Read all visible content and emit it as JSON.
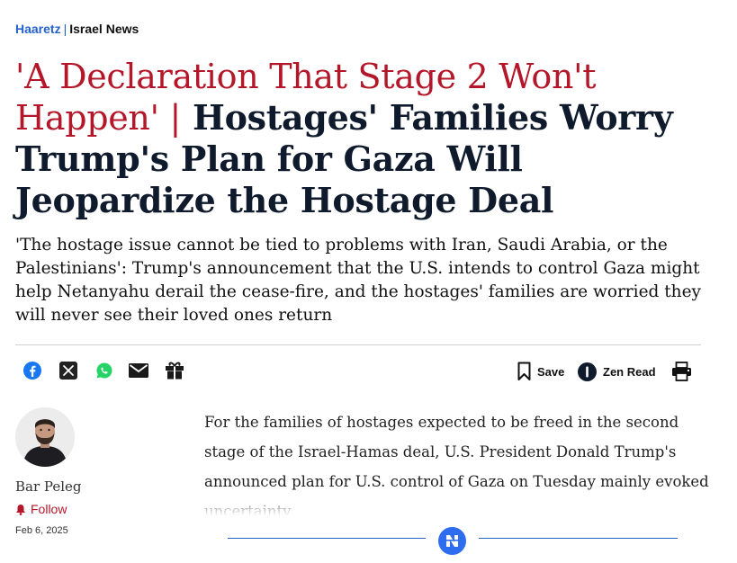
{
  "breadcrumb": {
    "brand": "Haaretz",
    "separator": "|",
    "section": "Israel News"
  },
  "headline": {
    "kicker": "'A Declaration That Stage 2 Won't Happen' |",
    "title": "Hostages' Families Worry Trump's Plan for Gaza Will Jeopardize the Hostage Deal"
  },
  "subhead": "'The hostage issue cannot be tied to problems with Iran, Saudi Arabia, or the Palestinians': Trump's announcement that the U.S. intends to control Gaza might help Netanyahu derail the cease-fire, and the hostages' families are worried they will never see their loved ones return",
  "share": {
    "icons": [
      "facebook-icon",
      "x-icon",
      "whatsapp-icon",
      "email-icon",
      "gift-icon"
    ]
  },
  "toolbar": {
    "save_label": "Save",
    "zen_label": "Zen Read",
    "print_icon": "print-icon"
  },
  "author": {
    "name": "Bar Peleg",
    "follow_label": "Follow",
    "date": "Feb 6, 2025"
  },
  "article": {
    "body": "For the families of hostages expected to be freed in the second stage of the Israel-Hamas deal, U.S. President Donald Trump's announced plan for U.S. control of Gaza on Tuesday mainly evoked uncertainty"
  },
  "colors": {
    "brand_blue": "#2563c9",
    "kicker_red": "#b5172a",
    "headline_navy": "#0f1b2d",
    "facebook": "#1877f2",
    "whatsapp": "#25d366"
  }
}
